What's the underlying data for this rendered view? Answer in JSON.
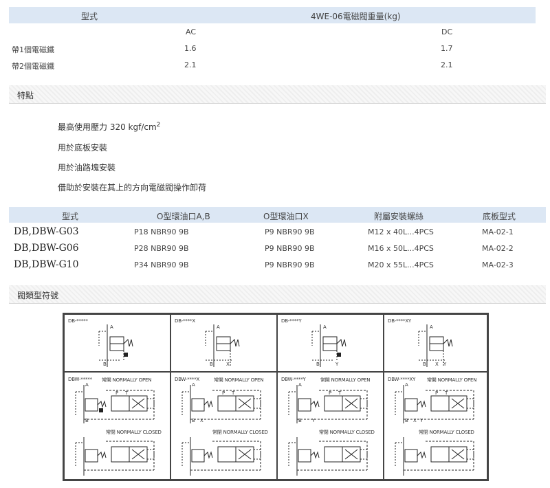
{
  "weight": {
    "header": [
      "型式",
      "4WE-06電磁閥重量(kg)"
    ],
    "sub": [
      "AC",
      "DC"
    ],
    "rows": [
      {
        "label": "帶1個電磁鐵",
        "ac": "1.6",
        "dc": "1.7"
      },
      {
        "label": "帶2個電磁鐵",
        "ac": "2.1",
        "dc": "2.1"
      }
    ]
  },
  "features": {
    "title": "特點",
    "items": [
      "最高使用壓力 320 kgf/cm",
      "用於底板安裝",
      "用於油路塊安裝",
      "借助於安裝在其上的方向電磁閥操作卸荷"
    ],
    "unit_sup": "2"
  },
  "parts": {
    "header": [
      "型式",
      "O型環油口A,B",
      "O型環油口X",
      "附屬安裝螺絲",
      "底板型式"
    ],
    "rows": [
      [
        "DB,DBW-G03",
        "P18 NBR90 9B",
        "P9 NBR90 9B",
        "M12 x 40L...4PCS",
        "MA-02-1"
      ],
      [
        "DB,DBW-G06",
        "P28 NBR90 9B",
        "P9 NBR90 9B",
        "M16 x 50L...4PCS",
        "MA-02-2"
      ],
      [
        "DB,DBW-G10",
        "P34 NBR90 9B",
        "P9 NBR90 9B",
        "M20 x 55L...4PCS",
        "MA-02-3"
      ]
    ]
  },
  "symbols": {
    "title": "閥類型符號",
    "top": [
      "DB-*****",
      "DB-****X",
      "DB-****Y",
      "DB-****XY"
    ],
    "bottom": [
      "DBW-*****",
      "DBW-****X",
      "DBW-****Y",
      "DBW-****XY"
    ],
    "open": "常開 NORMALLY OPEN",
    "closed": "常閉 NORMALLY CLOSED",
    "port_a": "A",
    "port_b": "B",
    "port_x": "X",
    "port_y": "Y",
    "port_p": "P",
    "port_t": "T"
  }
}
